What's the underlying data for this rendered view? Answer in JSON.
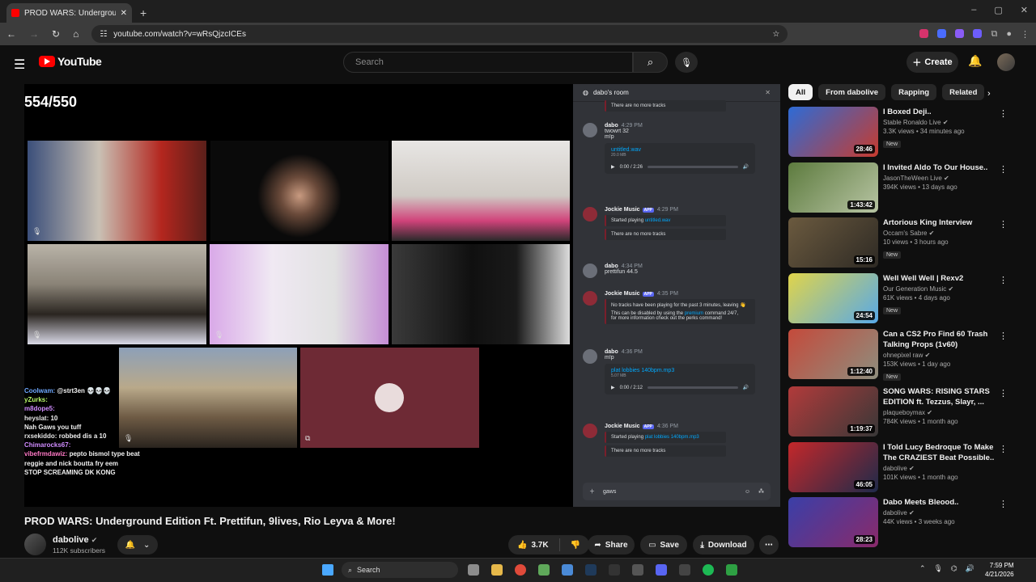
{
  "browser": {
    "tab_title": "PROD WARS: Underground Edition",
    "new_tab": "+",
    "url": "youtube.com/watch?v=wRsQjzcICEs",
    "controls": [
      "–",
      "▢",
      "✕"
    ]
  },
  "youtube": {
    "logo_text": "YouTube",
    "search_placeholder": "Search",
    "create_label": "Create"
  },
  "video": {
    "overlay_counter": "554/550",
    "title": "PROD WARS: Underground Edition Ft. Prettifun, 9lives, Rio Leyva & More!",
    "channel": "dabolive",
    "subscribers": "112K subscribers",
    "likes": "3.7K",
    "share_label": "Share",
    "save_label": "Save",
    "download_label": "Download"
  },
  "stream_chat": [
    {
      "user": "Coolwam:",
      "text": "@strt3en 💀💀💀",
      "color": "#6ea8ff"
    },
    {
      "user": "yZurks:",
      "text": "",
      "color": "#b8f86a"
    },
    {
      "user": "m8dope5:",
      "text": "",
      "color": "#d08cff"
    },
    {
      "user": "heyslat:",
      "text": "10",
      "color": "#e6e6e6"
    },
    {
      "user": "",
      "text": "Nah Gaws you tuff",
      "color": "#3a6bff"
    },
    {
      "user": "rxsekiddo:",
      "text": "robbed dis a 10",
      "color": "#e6e6e6"
    },
    {
      "user": "Chimarocks67:",
      "text": "",
      "color": "#d08cff"
    },
    {
      "user": "vibefrmdawiz:",
      "text": "pepto bismol type beat",
      "color": "#ff79c6"
    },
    {
      "user": "",
      "text": "reggie and nick boutta fry eem",
      "color": "#ff5555"
    },
    {
      "user": "",
      "text": "STOP SCREAMING DK KONG",
      "color": "#ff5555"
    }
  ],
  "discord": {
    "room": "dabo's room",
    "top_notice": "There are no more tracks",
    "messages": [
      {
        "name": "dabo",
        "time": "4:29 PM",
        "lines": [
          "twowrt 32",
          "m!p"
        ]
      },
      {
        "name": "Jockie Music",
        "badge": "APP",
        "time": "4:29 PM"
      },
      {
        "name": "dabo",
        "time": "4:34 PM",
        "lines": [
          "prettifun 44.5"
        ]
      },
      {
        "name": "Jockie Music",
        "badge": "APP",
        "time": "4:35 PM"
      },
      {
        "name": "dabo",
        "time": "4:36 PM",
        "lines": [
          "m!p"
        ]
      },
      {
        "name": "Jockie Music",
        "badge": "APP",
        "time": "4:36 PM"
      }
    ],
    "file1": "untitled.wav",
    "file1_size": "20.0 MB",
    "file1_time": "0:00 / 2:26",
    "started1": "Started playing",
    "started1_link": "untitled.wav",
    "no_more": "There are no more tracks",
    "inactive_line1": "No tracks have been playing for the past 3 minutes, leaving 👋",
    "inactive_line2": "This can be disabled by using the",
    "inactive_link": "premium",
    "inactive_line3": "command 24/7,",
    "inactive_line4": "for more information check out the",
    "inactive_cmd": "perks",
    "inactive_line5": "command!",
    "file2": "plat lobbies 140bpm.mp3",
    "file2_size": "5.07 MB",
    "file2_time": "0:00 / 2:12",
    "started2": "Started playing",
    "started2_link": "plat lobbies 140bpm.mp3",
    "no_more2": "There are no more tracks",
    "compose_text": "gaws"
  },
  "chips": [
    "All",
    "From dabolive",
    "Rapping",
    "Related"
  ],
  "recommendations": [
    {
      "title": "I Boxed Deji..",
      "channel": "Stable Ronaldo Live",
      "meta": "3.3K views • 34 minutes ago",
      "badge": "New",
      "duration": "28:46",
      "c1": "#2d6bd6",
      "c2": "#c73b2e"
    },
    {
      "title": "I Invited Aldo To Our House..",
      "channel": "JasonTheWeen Live",
      "meta": "394K views • 13 days ago",
      "badge": "",
      "duration": "1:43:42",
      "c1": "#5d7b3e",
      "c2": "#b7c4a3"
    },
    {
      "title": "Artorious King Interview",
      "channel": "Occam's Sabre",
      "meta": "10 views • 3 hours ago",
      "badge": "New",
      "duration": "15:16",
      "c1": "#6b5a3f",
      "c2": "#2e2a24"
    },
    {
      "title": "Well Well Well | Rexv2",
      "channel": "Our Generation Music",
      "meta": "61K views • 4 days ago",
      "badge": "New",
      "duration": "24:54",
      "c1": "#e0d44a",
      "c2": "#57a9e8"
    },
    {
      "title": "Can a CS2 Pro Find 60 Trash Talking Props (1v60)",
      "channel": "ohnepixel raw",
      "meta": "153K views • 1 day ago",
      "badge": "New",
      "duration": "1:12:40",
      "c1": "#c44a3b",
      "c2": "#8e8e7e"
    },
    {
      "title": "SONG WARS: RISING STARS EDITION ft. Tezzus, Slayr, ...",
      "channel": "plaqueboymax",
      "meta": "784K views • 1 month ago",
      "badge": "",
      "duration": "1:19:37",
      "c1": "#b23a3a",
      "c2": "#383838"
    },
    {
      "title": "I Told Lucy Bedroque To Make The CRAZIEST Beat Possible..",
      "channel": "dabolive",
      "meta": "101K views • 1 month ago",
      "badge": "",
      "duration": "46:05",
      "c1": "#c4282a",
      "c2": "#1e2a4a"
    },
    {
      "title": "Dabo Meets Bleood..",
      "channel": "dabolive",
      "meta": "44K views • 3 weeks ago",
      "badge": "",
      "duration": "28:23",
      "c1": "#3a3fa8",
      "c2": "#8a2a6a"
    }
  ],
  "taskbar": {
    "search": "Search",
    "time": "7:59 PM",
    "date": "4/21/2026"
  }
}
